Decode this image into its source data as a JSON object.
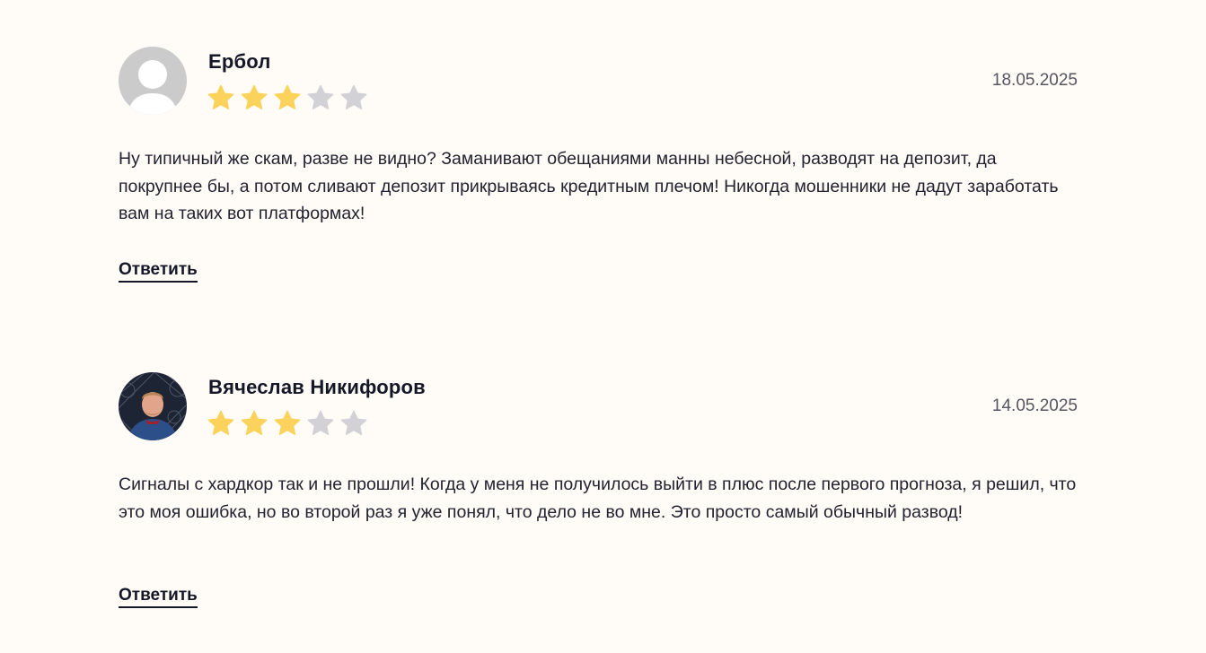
{
  "colors": {
    "background": "#fffbf7",
    "star_filled": "#fbd35c",
    "star_empty": "#d2d2d6",
    "text": "#23232f",
    "date": "#55565f"
  },
  "comments": [
    {
      "author": "Ербол",
      "rating": 3,
      "rating_max": 5,
      "date": "18.05.2025",
      "avatar": "default-user-icon",
      "text": "Ну типичный же скам, разве не видно? Заманивают обещаниями манны небесной, разводят на депозит, да покрупнее бы, а потом сливают депозит прикрываясь кредитным плечом! Никогда мошенники не дадут заработать вам на таких вот платформах!",
      "reply_label": "Ответить"
    },
    {
      "author": "Вячеслав Никифоров",
      "rating": 3,
      "rating_max": 5,
      "date": "14.05.2025",
      "avatar": "user-photo",
      "text": "Сигналы с хардкор так и не прошли! Когда у меня не получилось выйти в плюс после первого прогноза, я решил, что это моя ошибка, но во второй раз я уже понял, что дело не во мне. Это просто самый обычный развод!",
      "reply_label": "Ответить"
    }
  ]
}
